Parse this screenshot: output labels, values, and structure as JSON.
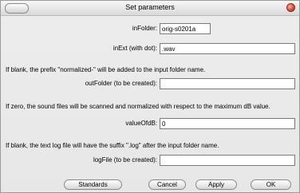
{
  "window": {
    "title": "Set parameters"
  },
  "fields": {
    "inFolder": {
      "label": "inFolder:",
      "value": "orig-s0201a"
    },
    "inExt": {
      "label": "inExt (with dot):",
      "value": ".wav"
    },
    "outFolder": {
      "label": "outFolder (to be created):",
      "value": ""
    },
    "valueOfdB": {
      "label": "valueOfdB:",
      "value": "0"
    },
    "logFile": {
      "label": "logFile (to be created):",
      "value": ""
    }
  },
  "notes": {
    "outFolder": "If blank, the prefix \"normalized-\" will be added to the input folder name.",
    "valueOfdB": "If zero, the sound files will be scanned and normalized with respect to the maximum dB value.",
    "logFile": "If blank, the text log file will have the suffix \".log\" after the input folder name."
  },
  "buttons": {
    "standards": "Standards",
    "cancel": "Cancel",
    "apply": "Apply",
    "ok": "OK"
  }
}
